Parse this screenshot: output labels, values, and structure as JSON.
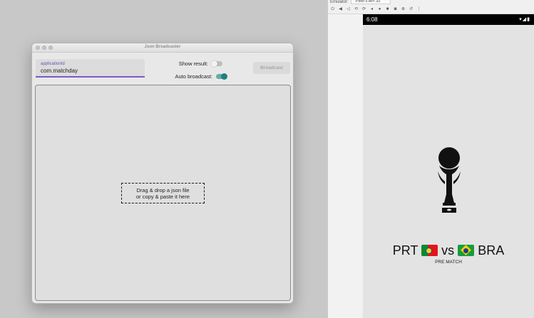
{
  "window": {
    "title": "Json Broadcaster",
    "app_id_field": {
      "label": "applicationId",
      "value": "com.matchday"
    },
    "show_result": {
      "label": "Show result:",
      "enabled": false
    },
    "auto_broadcast": {
      "label": "Auto broadcast:",
      "enabled": true
    },
    "broadcast_button": "Broadcast",
    "drop_zone": {
      "line1": "Drag & drop a json file",
      "line2": "or copy & paste it here"
    },
    "colors": {
      "accent": "#1f8080",
      "field_underline": "#7a5cc0"
    }
  },
  "emulator": {
    "header_name": "Emulator:",
    "device_tab": "Pixel 5 API 33",
    "toolbar_icons": [
      "power-icon",
      "volume-up-icon",
      "volume-down-icon",
      "rotate-left-icon",
      "rotate-right-icon",
      "back-icon",
      "home-icon",
      "overview-icon",
      "camera-icon",
      "zoom-icon",
      "restore-icon",
      "more-icon"
    ]
  },
  "phone": {
    "time": "6:08",
    "match": {
      "home": "PRT",
      "vs": "vs",
      "away": "BRA",
      "status": "PRE MATCH"
    }
  }
}
